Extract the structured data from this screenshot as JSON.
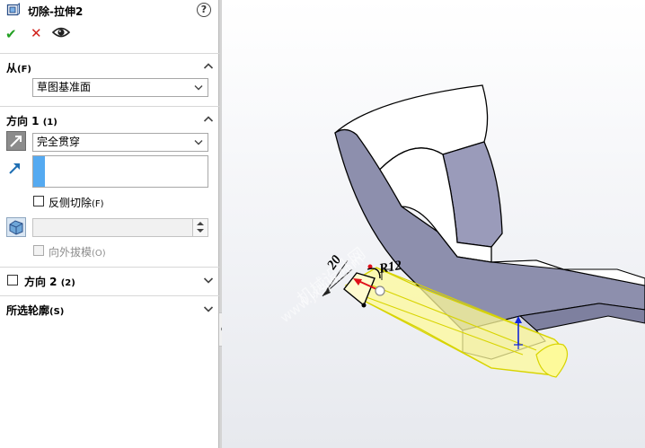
{
  "feature": {
    "title": "切除-拉伸2",
    "help_label": "?"
  },
  "confirm": {
    "ok_label": "✔",
    "cancel_label": "✕"
  },
  "from_section": {
    "label": "从",
    "shortcut": "(F)",
    "selected": "草图基准面"
  },
  "direction1": {
    "label": "方向 1",
    "shortcut": "(1)",
    "end_condition": "完全贯穿",
    "flip_side_label": "反侧切除",
    "flip_side_shortcut": "(F)",
    "flip_side_checked": false,
    "draft_value": "",
    "draft_outward_label": "向外拔模",
    "draft_outward_shortcut": "(O)",
    "draft_outward_enabled": false
  },
  "direction2": {
    "label": "方向 2",
    "shortcut": "(2)",
    "checked": false
  },
  "selected_contours": {
    "label": "所选轮廓",
    "shortcut": "(S)"
  },
  "viewport": {
    "dimension_radius": "R12",
    "dimension_length": "20",
    "watermark_line1": "机械设计网",
    "watermark_line2": "www.jxsjw.com"
  },
  "colors": {
    "accent_blue": "#55aaf1",
    "ok_green": "#23a023",
    "cancel_red": "#d0211b",
    "preview_yellow": "#fdfa9a",
    "preview_outline": "#d8d400",
    "part_face_shade": "#8d8fad"
  }
}
